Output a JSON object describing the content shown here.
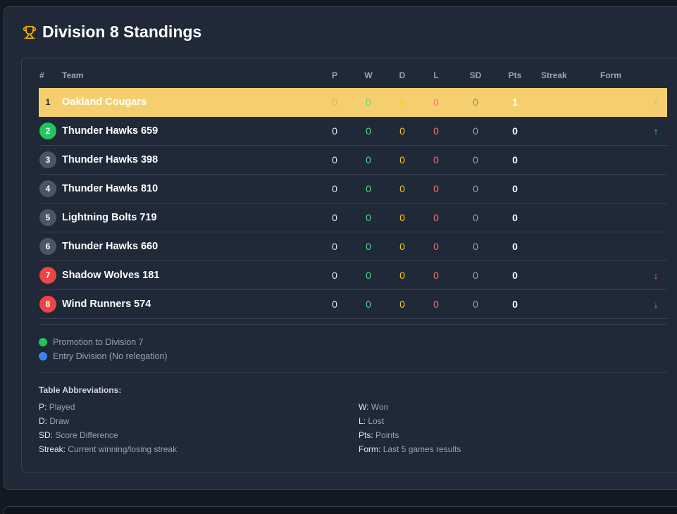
{
  "title": "Division 8 Standings",
  "columns": {
    "rank": "#",
    "team": "Team",
    "p": "P",
    "w": "W",
    "d": "D",
    "l": "L",
    "sd": "SD",
    "pts": "Pts",
    "streak": "Streak",
    "form": "Form"
  },
  "rows": [
    {
      "rank": "1",
      "team": "Oakland Cougars",
      "p": "0",
      "w": "0",
      "d": "0",
      "l": "0",
      "sd": "0",
      "pts": "1",
      "trend": "↑"
    },
    {
      "rank": "2",
      "team": "Thunder Hawks 659",
      "p": "0",
      "w": "0",
      "d": "0",
      "l": "0",
      "sd": "0",
      "pts": "0",
      "trend": "↑"
    },
    {
      "rank": "3",
      "team": "Thunder Hawks 398",
      "p": "0",
      "w": "0",
      "d": "0",
      "l": "0",
      "sd": "0",
      "pts": "0",
      "trend": ""
    },
    {
      "rank": "4",
      "team": "Thunder Hawks 810",
      "p": "0",
      "w": "0",
      "d": "0",
      "l": "0",
      "sd": "0",
      "pts": "0",
      "trend": ""
    },
    {
      "rank": "5",
      "team": "Lightning Bolts 719",
      "p": "0",
      "w": "0",
      "d": "0",
      "l": "0",
      "sd": "0",
      "pts": "0",
      "trend": ""
    },
    {
      "rank": "6",
      "team": "Thunder Hawks 660",
      "p": "0",
      "w": "0",
      "d": "0",
      "l": "0",
      "sd": "0",
      "pts": "0",
      "trend": ""
    },
    {
      "rank": "7",
      "team": "Shadow Wolves 181",
      "p": "0",
      "w": "0",
      "d": "0",
      "l": "0",
      "sd": "0",
      "pts": "0",
      "trend": "↓"
    },
    {
      "rank": "8",
      "team": "Wind Runners 574",
      "p": "0",
      "w": "0",
      "d": "0",
      "l": "0",
      "sd": "0",
      "pts": "0",
      "trend": "↓"
    }
  ],
  "legend": [
    {
      "label": "Promotion to Division 7",
      "color": "#22c55e"
    },
    {
      "label": "Entry Division (No relegation)",
      "color": "#3b82f6"
    }
  ],
  "abbreviations": {
    "title": "Table Abbreviations:",
    "items": [
      {
        "key": "P:",
        "desc": "Played"
      },
      {
        "key": "W:",
        "desc": "Won"
      },
      {
        "key": "D:",
        "desc": "Draw"
      },
      {
        "key": "L:",
        "desc": "Lost"
      },
      {
        "key": "SD:",
        "desc": "Score Difference"
      },
      {
        "key": "Pts:",
        "desc": "Points"
      },
      {
        "key": "Streak:",
        "desc": "Current winning/losing streak"
      },
      {
        "key": "Form:",
        "desc": "Last 5 games results"
      }
    ]
  },
  "colors": {
    "highlight": "#f5cf6e",
    "promotion": "#22c55e",
    "relegation": "#ef4444"
  }
}
